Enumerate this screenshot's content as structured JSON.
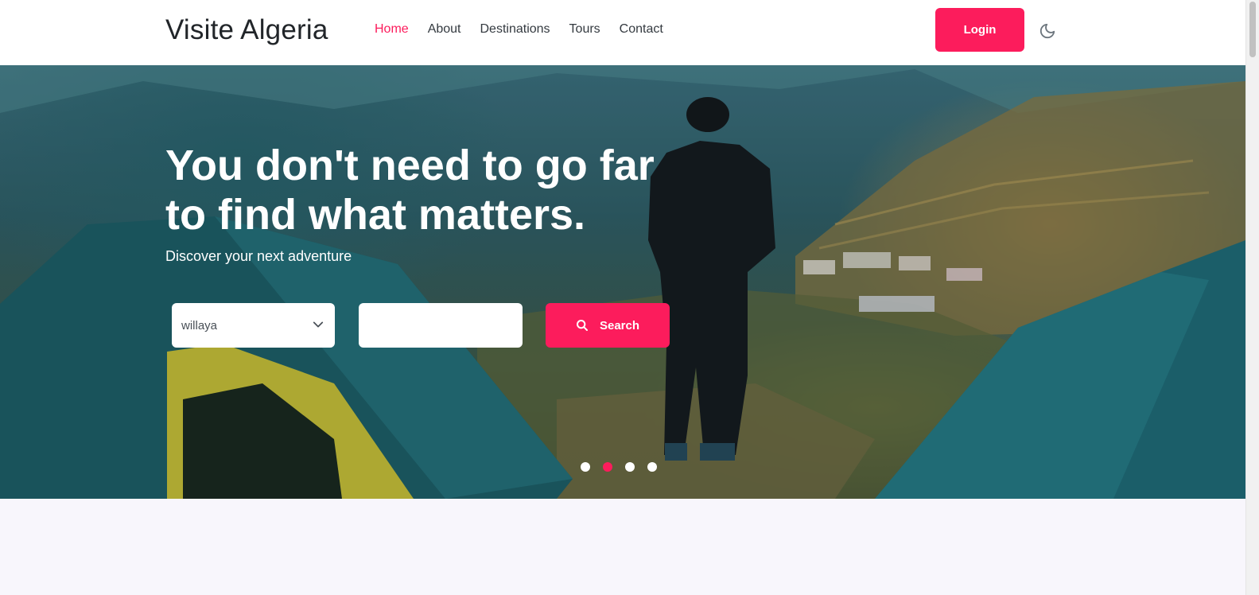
{
  "navbar": {
    "brand": "Visite Algeria",
    "links": [
      {
        "label": "Home",
        "active": true
      },
      {
        "label": "About",
        "active": false
      },
      {
        "label": "Destinations",
        "active": false
      },
      {
        "label": "Tours",
        "active": false
      },
      {
        "label": "Contact",
        "active": false
      }
    ],
    "login_label": "Login",
    "theme_icon": "moon-icon"
  },
  "hero": {
    "title": "You don't need to go far to find what matters.",
    "subtitle": "Discover your next adventure",
    "search": {
      "select_value": "willaya",
      "input_value": "",
      "button_label": "Search",
      "button_icon": "search-icon"
    },
    "carousel": {
      "slides": 4,
      "active_index": 1
    }
  },
  "colors": {
    "accent": "#fc1c5c",
    "text_dark": "#212529",
    "background": "#f8f6fc"
  }
}
